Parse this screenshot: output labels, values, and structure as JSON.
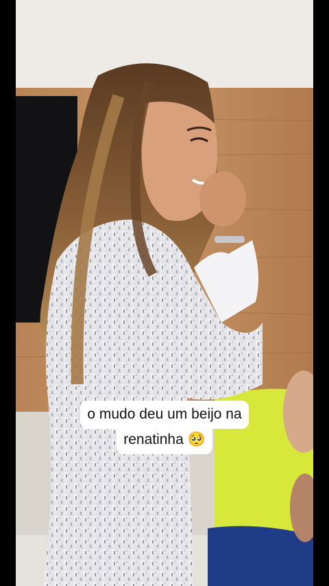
{
  "caption": {
    "line1": "o mudo deu um beijo na",
    "line2": "renatinha 🥺"
  }
}
